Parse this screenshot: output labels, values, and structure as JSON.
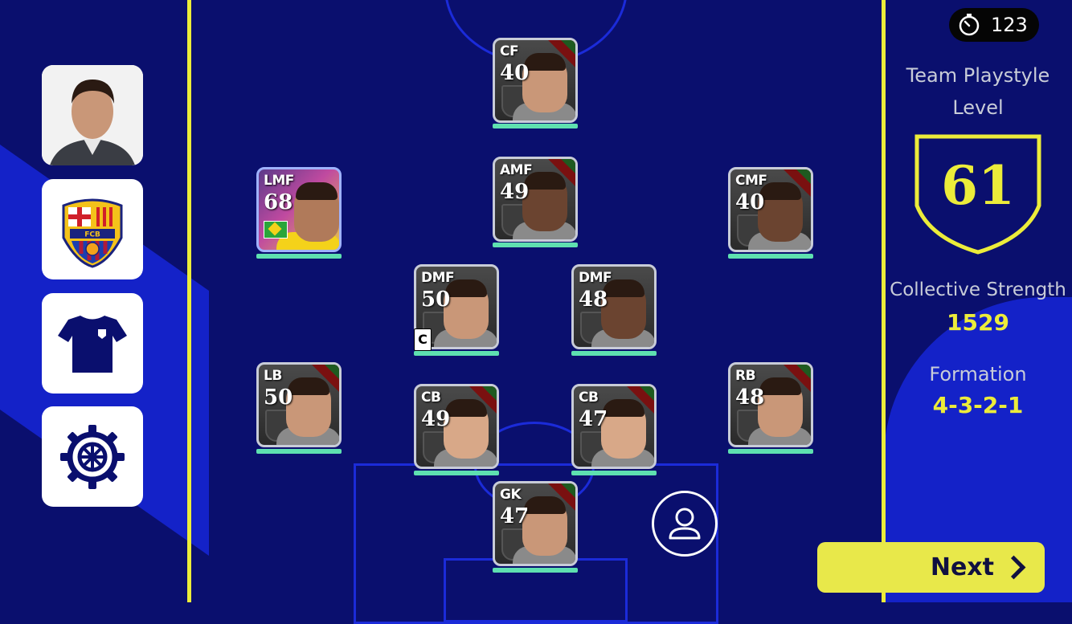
{
  "timer": {
    "value": "123",
    "icon": "stopwatch-icon"
  },
  "sidebar": {
    "items": [
      {
        "name": "manager",
        "icon": "manager-portrait"
      },
      {
        "name": "club-crest",
        "icon": "fcb-crest-icon"
      },
      {
        "name": "kit",
        "icon": "shirt-icon"
      },
      {
        "name": "settings",
        "icon": "gear-icon"
      }
    ]
  },
  "players": [
    {
      "pos": "CF",
      "rating": "40"
    },
    {
      "pos": "AMF",
      "rating": "49"
    },
    {
      "pos": "LMF",
      "rating": "68"
    },
    {
      "pos": "CMF",
      "rating": "40"
    },
    {
      "pos": "DMF",
      "rating": "50"
    },
    {
      "pos": "DMF",
      "rating": "48"
    },
    {
      "pos": "LB",
      "rating": "50"
    },
    {
      "pos": "CB",
      "rating": "49"
    },
    {
      "pos": "CB",
      "rating": "47"
    },
    {
      "pos": "RB",
      "rating": "48"
    },
    {
      "pos": "GK",
      "rating": "47"
    }
  ],
  "captain_label": "C",
  "panel": {
    "playstyle_label_1": "Team Playstyle",
    "playstyle_label_2": "Level",
    "playstyle_value": "61",
    "strength_label": "Collective Strength",
    "strength_value": "1529",
    "formation_label": "Formation",
    "formation_value": "4-3-2-1"
  },
  "next_button": {
    "label": "Next"
  },
  "colors": {
    "accent": "#ecec3a",
    "background": "#0a0f6e",
    "band": "#1422c8",
    "bar": "#5ee0b0"
  }
}
